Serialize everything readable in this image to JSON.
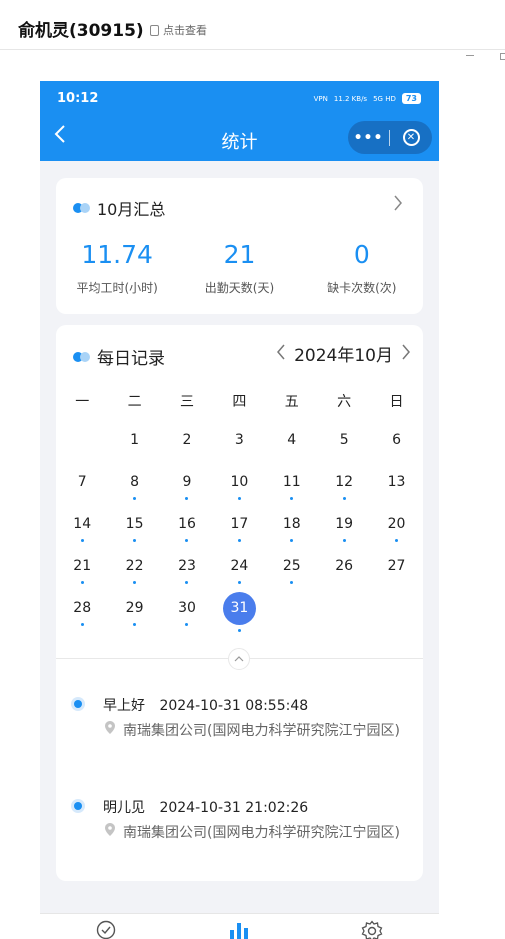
{
  "window": {
    "chat_title": "俞机灵(30915)",
    "check_link": "点击查看"
  },
  "status_bar": {
    "time": "10:12",
    "vpn": "VPN",
    "net_speed": "11.2 KB/s",
    "network": "5G HD",
    "battery": "73"
  },
  "navbar": {
    "back_icon": "chevron-left-icon",
    "title": "统计",
    "more_label": "•••",
    "close_icon": "close-circle-icon"
  },
  "summary": {
    "title": "10月汇总",
    "stats": [
      {
        "value": "11.74",
        "label": "平均工时(小时)"
      },
      {
        "value": "21",
        "label": "出勤天数(天)"
      },
      {
        "value": "0",
        "label": "缺卡次数(次)"
      }
    ]
  },
  "daily": {
    "title": "每日记录",
    "month_label": "2024年10月",
    "weekdays": [
      "一",
      "二",
      "三",
      "四",
      "五",
      "六",
      "日"
    ],
    "weeks": [
      [
        {
          "d": ""
        },
        {
          "d": "1"
        },
        {
          "d": "2"
        },
        {
          "d": "3"
        },
        {
          "d": "4"
        },
        {
          "d": "5"
        },
        {
          "d": "6"
        }
      ],
      [
        {
          "d": "7"
        },
        {
          "d": "8",
          "dot": true
        },
        {
          "d": "9",
          "dot": true
        },
        {
          "d": "10",
          "dot": true
        },
        {
          "d": "11",
          "dot": true
        },
        {
          "d": "12",
          "dot": true
        },
        {
          "d": "13"
        }
      ],
      [
        {
          "d": "14",
          "dot": true
        },
        {
          "d": "15",
          "dot": true
        },
        {
          "d": "16",
          "dot": true
        },
        {
          "d": "17",
          "dot": true
        },
        {
          "d": "18",
          "dot": true
        },
        {
          "d": "19",
          "dot": true
        },
        {
          "d": "20",
          "dot": true
        }
      ],
      [
        {
          "d": "21",
          "dot": true
        },
        {
          "d": "22",
          "dot": true
        },
        {
          "d": "23",
          "dot": true
        },
        {
          "d": "24",
          "dot": true
        },
        {
          "d": "25",
          "dot": true
        },
        {
          "d": "26"
        },
        {
          "d": "27"
        }
      ],
      [
        {
          "d": "28",
          "dot": true
        },
        {
          "d": "29",
          "dot": true
        },
        {
          "d": "30",
          "dot": true
        },
        {
          "d": "31",
          "dot": true,
          "selected": true
        },
        {
          "d": ""
        },
        {
          "d": ""
        },
        {
          "d": ""
        }
      ]
    ],
    "records": [
      {
        "greeting": "早上好",
        "time": "2024-10-31 08:55:48",
        "location": "南瑞集团公司(国网电力科学研究院江宁园区)"
      },
      {
        "greeting": "明儿见",
        "time": "2024-10-31 21:02:26",
        "location": "南瑞集团公司(国网电力科学研究院江宁园区)"
      }
    ]
  },
  "tabbar": {
    "tabs": [
      {
        "icon": "check-circle-icon"
      },
      {
        "icon": "bar-chart-icon",
        "active": true
      },
      {
        "icon": "gear-icon"
      }
    ]
  },
  "colors": {
    "primary": "#1a8ff2",
    "selected_day": "#4a7dec",
    "background": "#f2f3f7"
  }
}
